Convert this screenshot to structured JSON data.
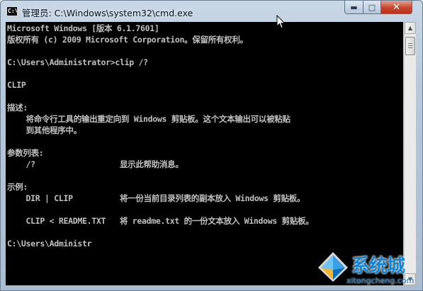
{
  "window": {
    "title": "管理员: C:\\Windows\\system32\\cmd.exe",
    "icon": "cmd-icon",
    "controls": {
      "minimize": "minimize-icon",
      "maximize": "maximize-icon",
      "close": "close-icon"
    }
  },
  "console": {
    "lines": [
      "Microsoft Windows [版本 6.1.7601]",
      "版权所有 (c) 2009 Microsoft Corporation。保留所有权利。",
      "",
      "C:\\Users\\Administrator>clip /?",
      "",
      "CLIP",
      "",
      "描述:",
      "    将命令行工具的输出重定向到 Windows 剪贴板。这个文本输出可以被粘贴",
      "    到其他程序中。",
      "",
      "参数列表:",
      "    /?                  显示此帮助消息。",
      "",
      "示例:",
      "    DIR | CLIP          将一份当前目录列表的副本放入 Windows 剪贴板。",
      "",
      "    CLIP < README.TXT   将 readme.txt 的一份文本放入 Windows 剪贴板。",
      "",
      "C:\\Users\\Administr"
    ],
    "text_color": "#c0c0c0",
    "background": "#000000"
  },
  "watermark": {
    "text": "系统城",
    "url": "xitongcheng.com",
    "color": "#0f85d4"
  }
}
